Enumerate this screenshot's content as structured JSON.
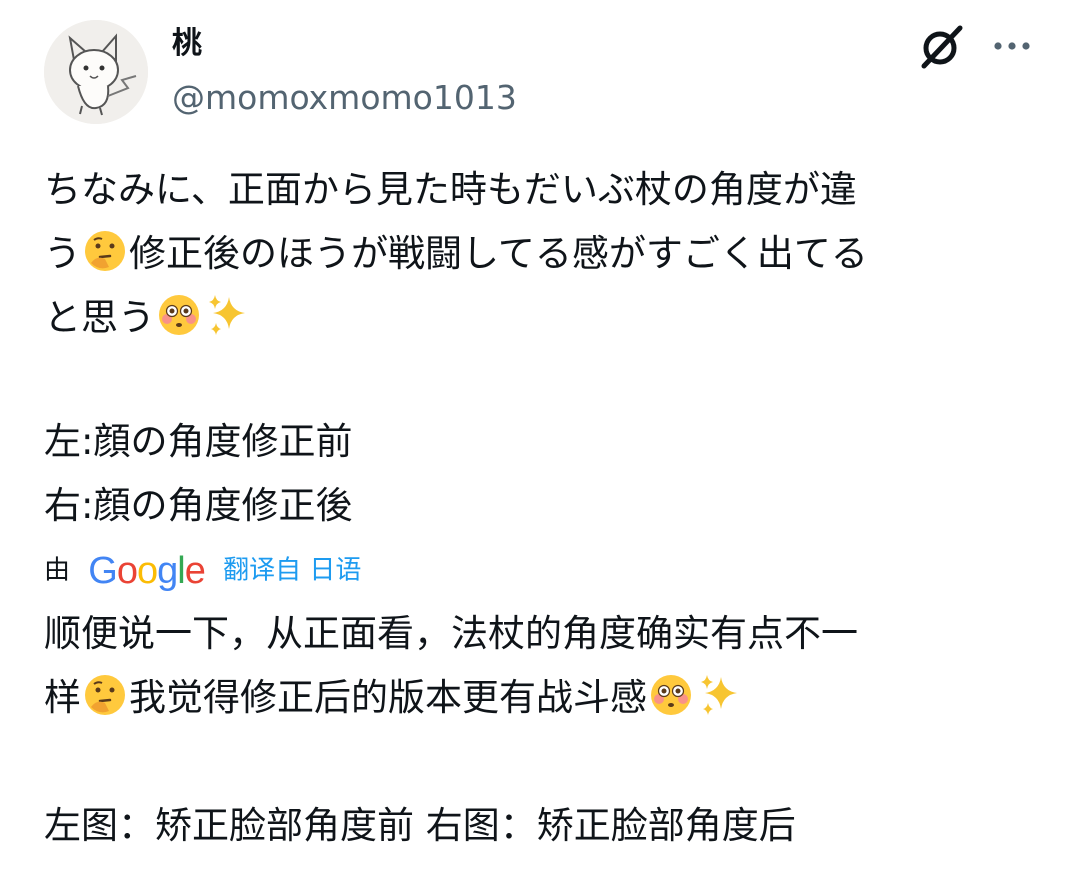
{
  "user": {
    "display_name": "桃",
    "handle": "@momoxmomo1013"
  },
  "header": {
    "grok_icon": "grok-icon",
    "more_icon": "more-horizontal-icon"
  },
  "original": {
    "line1": "ちなみに、正面から見た時もだいぶ杖の角度が違",
    "line2a": "う",
    "line2b": "修正後のほうが戦闘してる感がすごく出てる",
    "line3a": "と思う",
    "line5": "左:顔の角度修正前",
    "line6": "右:顔の角度修正後"
  },
  "translation_bar": {
    "by_label": "由",
    "google_logo": "Google",
    "translated_from": "翻译自 日语"
  },
  "translated": {
    "line1": "顺便说一下，从正面看，法杖的角度确实有点不一",
    "line2a": "样",
    "line2b": "我觉得修正后的版本更有战斗感",
    "line4": "左图：矫正脸部角度前 右图：矫正脸部角度后"
  },
  "emoji": {
    "thinking": "thinking-face-emoji",
    "flushed": "flushed-face-emoji",
    "sparkles": "sparkles-emoji"
  },
  "colors": {
    "text": "#0f1419",
    "secondary": "#536471",
    "link": "#1d9bf0"
  }
}
